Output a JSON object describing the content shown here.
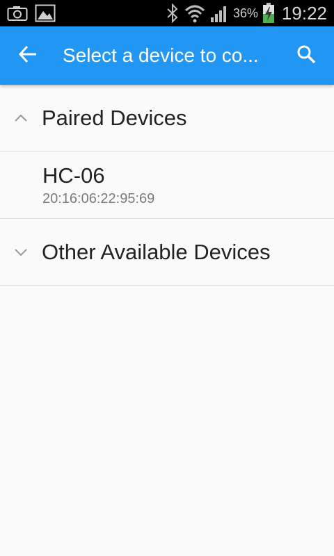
{
  "status_bar": {
    "battery_percent": "36%",
    "time": "19:22",
    "icons": [
      "camera-icon",
      "gallery-icon",
      "bluetooth-icon",
      "wifi-icon",
      "signal-icon",
      "battery-charging-icon"
    ]
  },
  "app_bar": {
    "title": "Select a device to co...",
    "back_icon": "arrow-left-icon",
    "search_icon": "search-icon",
    "color": "#2196f3"
  },
  "sections": {
    "paired": {
      "title": "Paired Devices",
      "expanded": true
    },
    "other": {
      "title": "Other Available Devices",
      "expanded": false
    }
  },
  "paired_devices": [
    {
      "name": "HC-06",
      "address": "20:16:06:22:95:69"
    }
  ]
}
